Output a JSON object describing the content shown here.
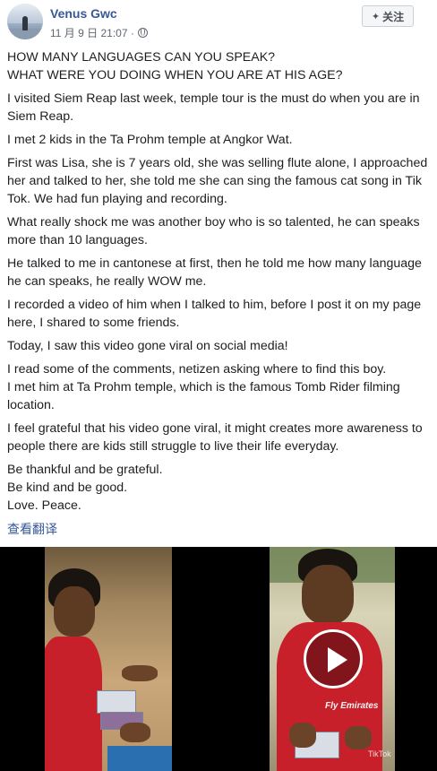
{
  "post": {
    "author": "Venus Gwc",
    "timestamp": "11 月 9 日 21:07 · ",
    "follow_label": "关注",
    "follow_icon": "follow-icon",
    "paragraphs": [
      "HOW MANY LANGUAGES CAN YOU SPEAK?\nWHAT WERE YOU DOING WHEN YOU ARE AT HIS AGE?",
      "I visited Siem Reap last week, temple tour is the must do when you are in Siem Reap.",
      "I met 2 kids in the Ta Prohm temple at Angkor Wat.",
      "First was Lisa, she is 7 years old, she was selling flute alone, I approached her and talked to her, she told me she can sing the famous cat song in Tik Tok. We had fun playing and recording.",
      "What really shock me was another boy who is so talented, he can speaks more than 10 languages.",
      "He talked to me in cantonese at first, then he told me how many language he can speaks, he really WOW me.",
      "I recorded a video of him when I talked to him, before I post it on my page here, I shared to some friends.",
      "Today, I saw this video gone viral on social media!",
      "I read some of the comments, netizen asking where to find this boy.\nI met him at Ta Prohm temple, which is the famous Tomb Rider filming location.",
      "I feel grateful that his video gone viral, it might creates more awareness to people there are kids still struggle to live their life everyday.",
      "Be thankful and be grateful.\nBe kind and be good.\nLove. Peace."
    ],
    "translate_link": "查看翻译"
  },
  "media": {
    "right_video_watermark": "TikTok",
    "shirt_text": "Fly Emirates",
    "play_icon": "play-icon"
  }
}
